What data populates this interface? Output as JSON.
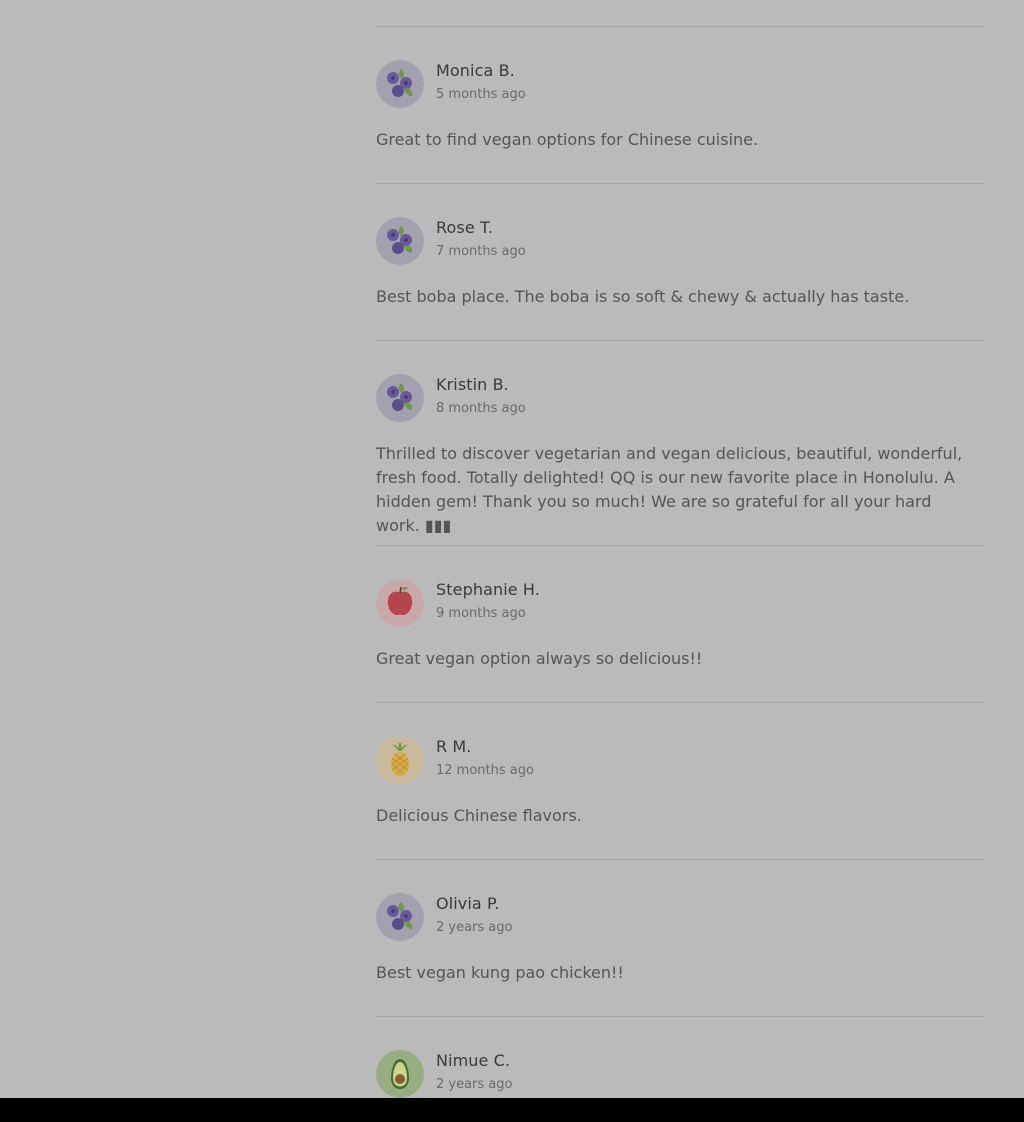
{
  "reviews": [
    {
      "name": "Monica B.",
      "time": "5 months ago",
      "text": "Great to find vegan options for Chinese cuisine.",
      "avatar": "blueberry-icon"
    },
    {
      "name": "Rose T.",
      "time": "7 months ago",
      "text": "Best boba place. The boba is so soft & chewy & actually has taste.",
      "avatar": "blueberry-icon"
    },
    {
      "name": "Kristin B.",
      "time": "8 months ago",
      "text": "Thrilled to discover vegetarian and vegan delicious, beautiful, wonderful, fresh food. Totally delighted! QQ is our new favorite place in Honolulu. A hidden gem! Thank you so much! We are so grateful for all your hard work. ▮▮▮",
      "avatar": "blueberry-icon"
    },
    {
      "name": "Stephanie H.",
      "time": "9 months ago",
      "text": "Great vegan option always so delicious!!",
      "avatar": "apple-icon"
    },
    {
      "name": "R M.",
      "time": "12 months ago",
      "text": "Delicious Chinese flavors.",
      "avatar": "pineapple-icon"
    },
    {
      "name": "Olivia P.",
      "time": "2 years ago",
      "text": "Best vegan kung pao chicken!!",
      "avatar": "blueberry-icon"
    },
    {
      "name": "Nimue C.",
      "time": "2 years ago",
      "text": "",
      "avatar": "avocado-icon"
    }
  ],
  "colors": {
    "background": "#bababa",
    "divider": "#a8a8a8",
    "name": "#3a3a3a",
    "time": "#6a6a6a",
    "body_text": "#555555"
  }
}
